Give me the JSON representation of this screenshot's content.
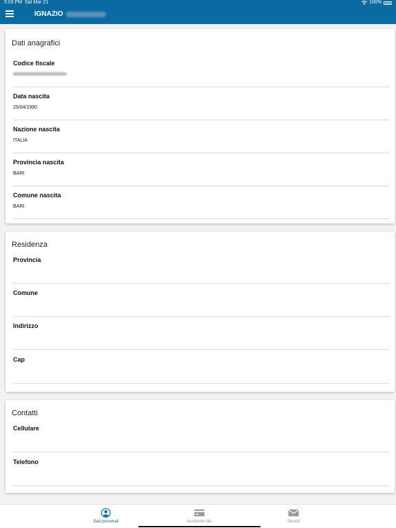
{
  "status_bar": {
    "time": "5:03 PM",
    "date": "Sat Mar 21",
    "battery": "100%",
    "wifi_icon": "wifi-icon",
    "battery_icon": "battery-icon"
  },
  "header": {
    "title": "IGNAZIO",
    "menu_icon": "hamburger-menu-icon",
    "background_color": "#0a6aa1"
  },
  "sections": {
    "anagrafici": {
      "title": "Dati anagrafici",
      "fields": [
        {
          "label": "Codice fiscale",
          "value": ""
        },
        {
          "label": "Data nascita",
          "value": "25/04/1990"
        },
        {
          "label": "Nazione nascita",
          "value": "ITALIA"
        },
        {
          "label": "Provincia nascita",
          "value": "BARI"
        },
        {
          "label": "Comune nascita",
          "value": "BARI"
        }
      ]
    },
    "residenza": {
      "title": "Residenza",
      "fields": [
        {
          "label": "Provincia",
          "value": ""
        },
        {
          "label": "Comune",
          "value": ""
        },
        {
          "label": "Indirizzo",
          "value": ""
        },
        {
          "label": "Cap",
          "value": ""
        }
      ]
    },
    "contatti": {
      "title": "Contatti",
      "fields": [
        {
          "label": "Cellulare",
          "value": ""
        },
        {
          "label": "Telefono",
          "value": ""
        }
      ]
    }
  },
  "tab_bar": {
    "active_color": "#0a6aa1",
    "tabs": [
      {
        "label": "Dati personali",
        "icon": "person-icon",
        "active": true
      },
      {
        "label": "Iscrizione UIL",
        "icon": "card-icon",
        "active": false
      },
      {
        "label": "Servizi",
        "icon": "envelope-icon",
        "active": false
      }
    ]
  }
}
